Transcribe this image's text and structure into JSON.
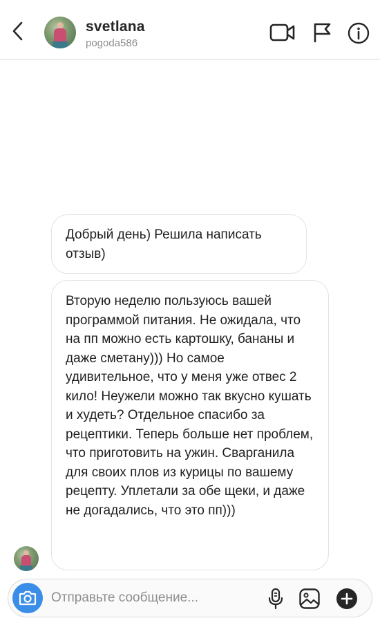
{
  "header": {
    "username": "svetlana",
    "handle": "pogoda586",
    "icons": [
      "back-arrow-icon",
      "video-call-icon",
      "flag-icon",
      "info-icon"
    ]
  },
  "messages": [
    {
      "text": "Добрый день) Решила написать отзыв)"
    },
    {
      "text": "Вторую неделю пользуюсь вашей программой питания. Не ожидала, что на пп можно есть картошку, бананы и даже сметану))) Но самое удивительное, что у меня уже отвес 2 кило! Неужели можно так вкусно кушать и худеть? Отдельное спасибо за рецептики. Теперь больше нет проблем, что приготовить на ужин. Сварганила для своих плов из курицы по вашему рецепту. Уплетали за обе щеки, и даже не догадались, что это пп)))"
    }
  ],
  "composer": {
    "placeholder": "Отправьте сообщение...",
    "value": "",
    "accent_color": "#3b8ee8",
    "icons": [
      "camera-icon",
      "microphone-icon",
      "gallery-icon",
      "plus-icon"
    ]
  }
}
